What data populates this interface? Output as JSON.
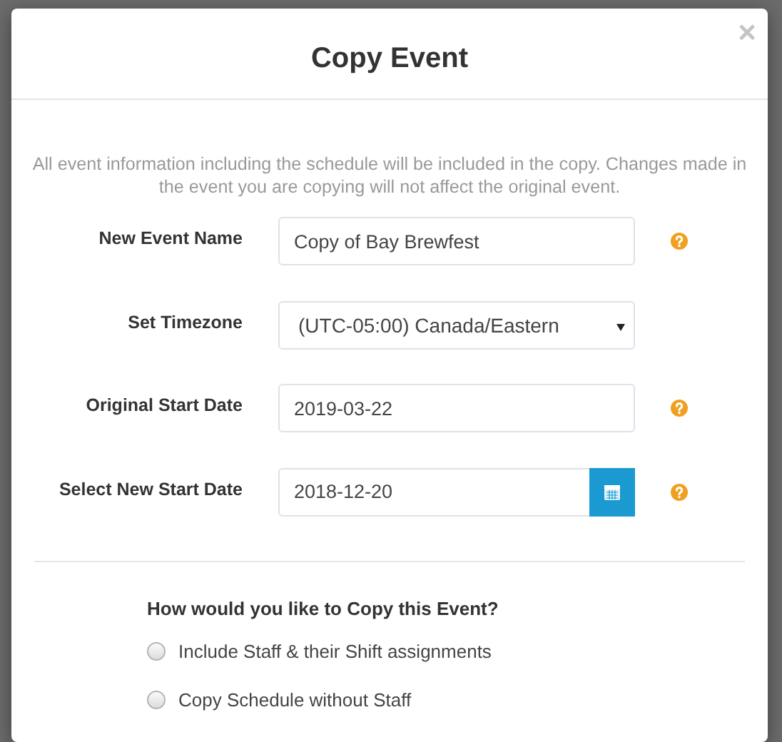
{
  "dialog": {
    "title": "Copy Event",
    "close": "×",
    "description": "All event information including the schedule will be included in the copy. Changes made in the event you are copying will not affect the original event.",
    "fields": [
      {
        "kind": "text",
        "label": "New Event Name",
        "value": "Copy of Bay Brewfest",
        "help": true
      },
      {
        "kind": "select",
        "label": "Set Timezone",
        "value": "(UTC-05:00) Canada/Eastern",
        "help": false
      },
      {
        "kind": "text",
        "label": "Original Start Date",
        "value": "2019-03-22",
        "help": true
      },
      {
        "kind": "date",
        "label": "Select New Start Date",
        "value": "2018-12-20",
        "help": true
      }
    ],
    "copy_options": {
      "question": "How would you like to Copy this Event?",
      "options": [
        {
          "label": "Include Staff & their Shift assignments",
          "selected": false
        },
        {
          "label": "Copy Schedule without Staff",
          "selected": false
        }
      ]
    }
  }
}
